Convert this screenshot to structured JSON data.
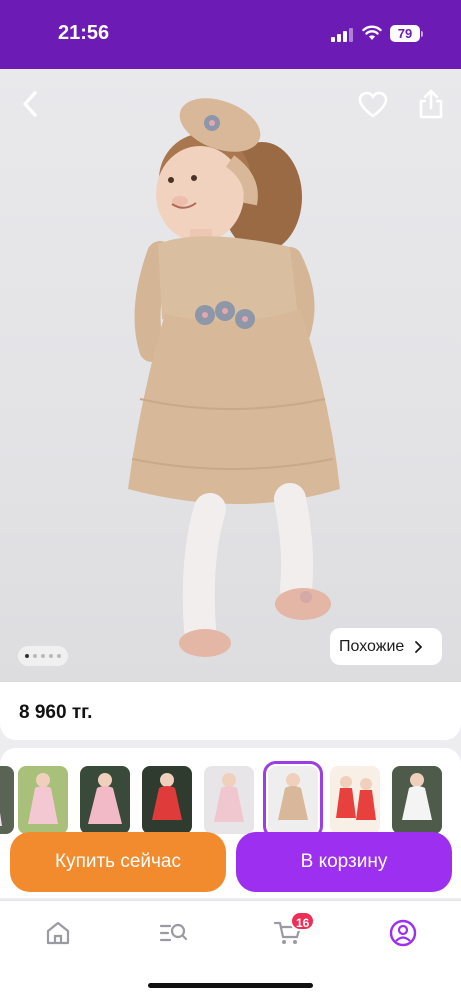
{
  "status_bar": {
    "time": "21:56",
    "battery": "79",
    "icons": [
      "signal-icon",
      "wifi-icon",
      "battery-icon"
    ],
    "background": "#6c1bb5"
  },
  "product": {
    "image_icons": [
      "back-icon",
      "heart-icon",
      "share-icon"
    ],
    "gallery_dots": 5,
    "gallery_active_dot": 1,
    "similar_label": "Похожие",
    "price": "8 960 тг."
  },
  "variants": {
    "count": 7,
    "selected_index": 4,
    "dress_colors": [
      "#f3c8d2",
      "#f2b9c6",
      "#e03b3b",
      "#f0c6cf",
      "#d8b79b",
      "#e8413d",
      "#f4f4f4"
    ],
    "background_colors": [
      "#a9c07a",
      "#3a4a3a",
      "#2f3b2f",
      "#e8e5e8",
      "#eeeeee",
      "#f8f0e6",
      "#4e5a4a"
    ]
  },
  "actions": {
    "buy_now": "Купить сейчас",
    "add_to_cart": "В корзину",
    "buy_color": "#f28a2e",
    "cart_color": "#9d2ff0"
  },
  "tabbar": {
    "items": [
      "home-icon",
      "catalog-search-icon",
      "cart-icon",
      "profile-icon"
    ],
    "cart_badge": "16",
    "active_color": "#9d2ff0"
  }
}
